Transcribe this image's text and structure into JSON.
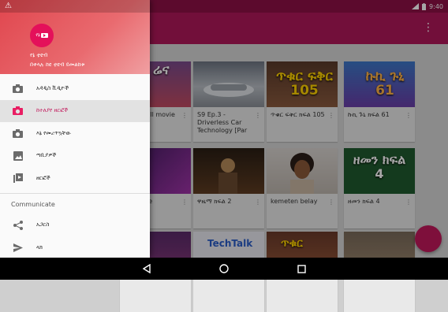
{
  "status_bar": {
    "time": "9:40",
    "icons": [
      "warning-icon",
      "signal-icon",
      "battery-icon"
    ]
  },
  "drawer": {
    "app_name": "የኔ ቲዩብ",
    "app_subtitle": "በቀላሉ ከዩ ቲዩብ ይመልከቱ",
    "logo_text": "የኔ",
    "items": [
      {
        "label": "አዳዲስ ቪዲዮች",
        "icon": "camera-icon",
        "active": false
      },
      {
        "label": "ከተለያየ ዘርፎች",
        "icon": "camera-icon",
        "active": true
      },
      {
        "label": "እኔ የመረጥኳቸው",
        "icon": "camera-icon",
        "active": false
      },
      {
        "label": "ጣቢያዎች",
        "icon": "image-icon",
        "active": false
      },
      {
        "label": "ዘርፎች",
        "icon": "playlist-icon",
        "active": false
      }
    ],
    "section_label": "Communicate",
    "communicate_items": [
      {
        "label": "አጋርስ",
        "icon": "share-icon"
      },
      {
        "label": "ላክ",
        "icon": "send-icon"
      }
    ]
  },
  "cards": [
    {
      "title": "arena full movie",
      "thumb_text": "ሬና"
    },
    {
      "title": "S9 Ep.3 - Driverless Car Technology [Par",
      "thumb_text": ""
    },
    {
      "title": "ጥቁር ፍቅር ክፍል 105",
      "thumb_text": "ጥቁር ፍቅር 105"
    },
    {
      "title": "ኩኪ ጉኒ ክፍል 61",
      "thumb_text": "ኩኪ ጉኒ 61"
    },
    {
      "title": "he Name",
      "thumb_text": ""
    },
    {
      "title": "ዋዜማ ክፍል 2",
      "thumb_text": ""
    },
    {
      "title": "kemeten belay",
      "thumb_text": ""
    },
    {
      "title": "ዘመን ክፍል 4",
      "thumb_text": "ዘመን ክፍል 4"
    },
    {
      "title": "",
      "thumb_text": ""
    },
    {
      "title": "",
      "thumb_text": "TechTalk"
    },
    {
      "title": "",
      "thumb_text": "ጥቁር"
    },
    {
      "title": "",
      "thumb_text": ""
    }
  ],
  "colors": {
    "primary": "#b0185a",
    "accent": "#c2185b",
    "drawer_header": "#e0464e"
  }
}
